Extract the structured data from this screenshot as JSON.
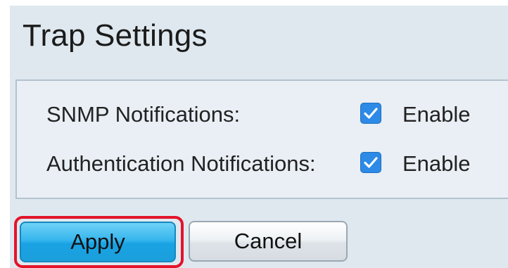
{
  "page": {
    "title": "Trap Settings"
  },
  "settings": [
    {
      "label": "SNMP Notifications:",
      "checked": true,
      "option_label": "Enable"
    },
    {
      "label": "Authentication Notifications:",
      "checked": true,
      "option_label": "Enable"
    }
  ],
  "buttons": {
    "apply_label": "Apply",
    "cancel_label": "Cancel"
  },
  "colors": {
    "background": "#dfe8ef",
    "checkbox": "#2d8ae6",
    "apply_button": "#36b6ee",
    "highlight_ring": "#e3142a"
  },
  "icons": {
    "checkbox_mark": "checkmark-icon"
  }
}
